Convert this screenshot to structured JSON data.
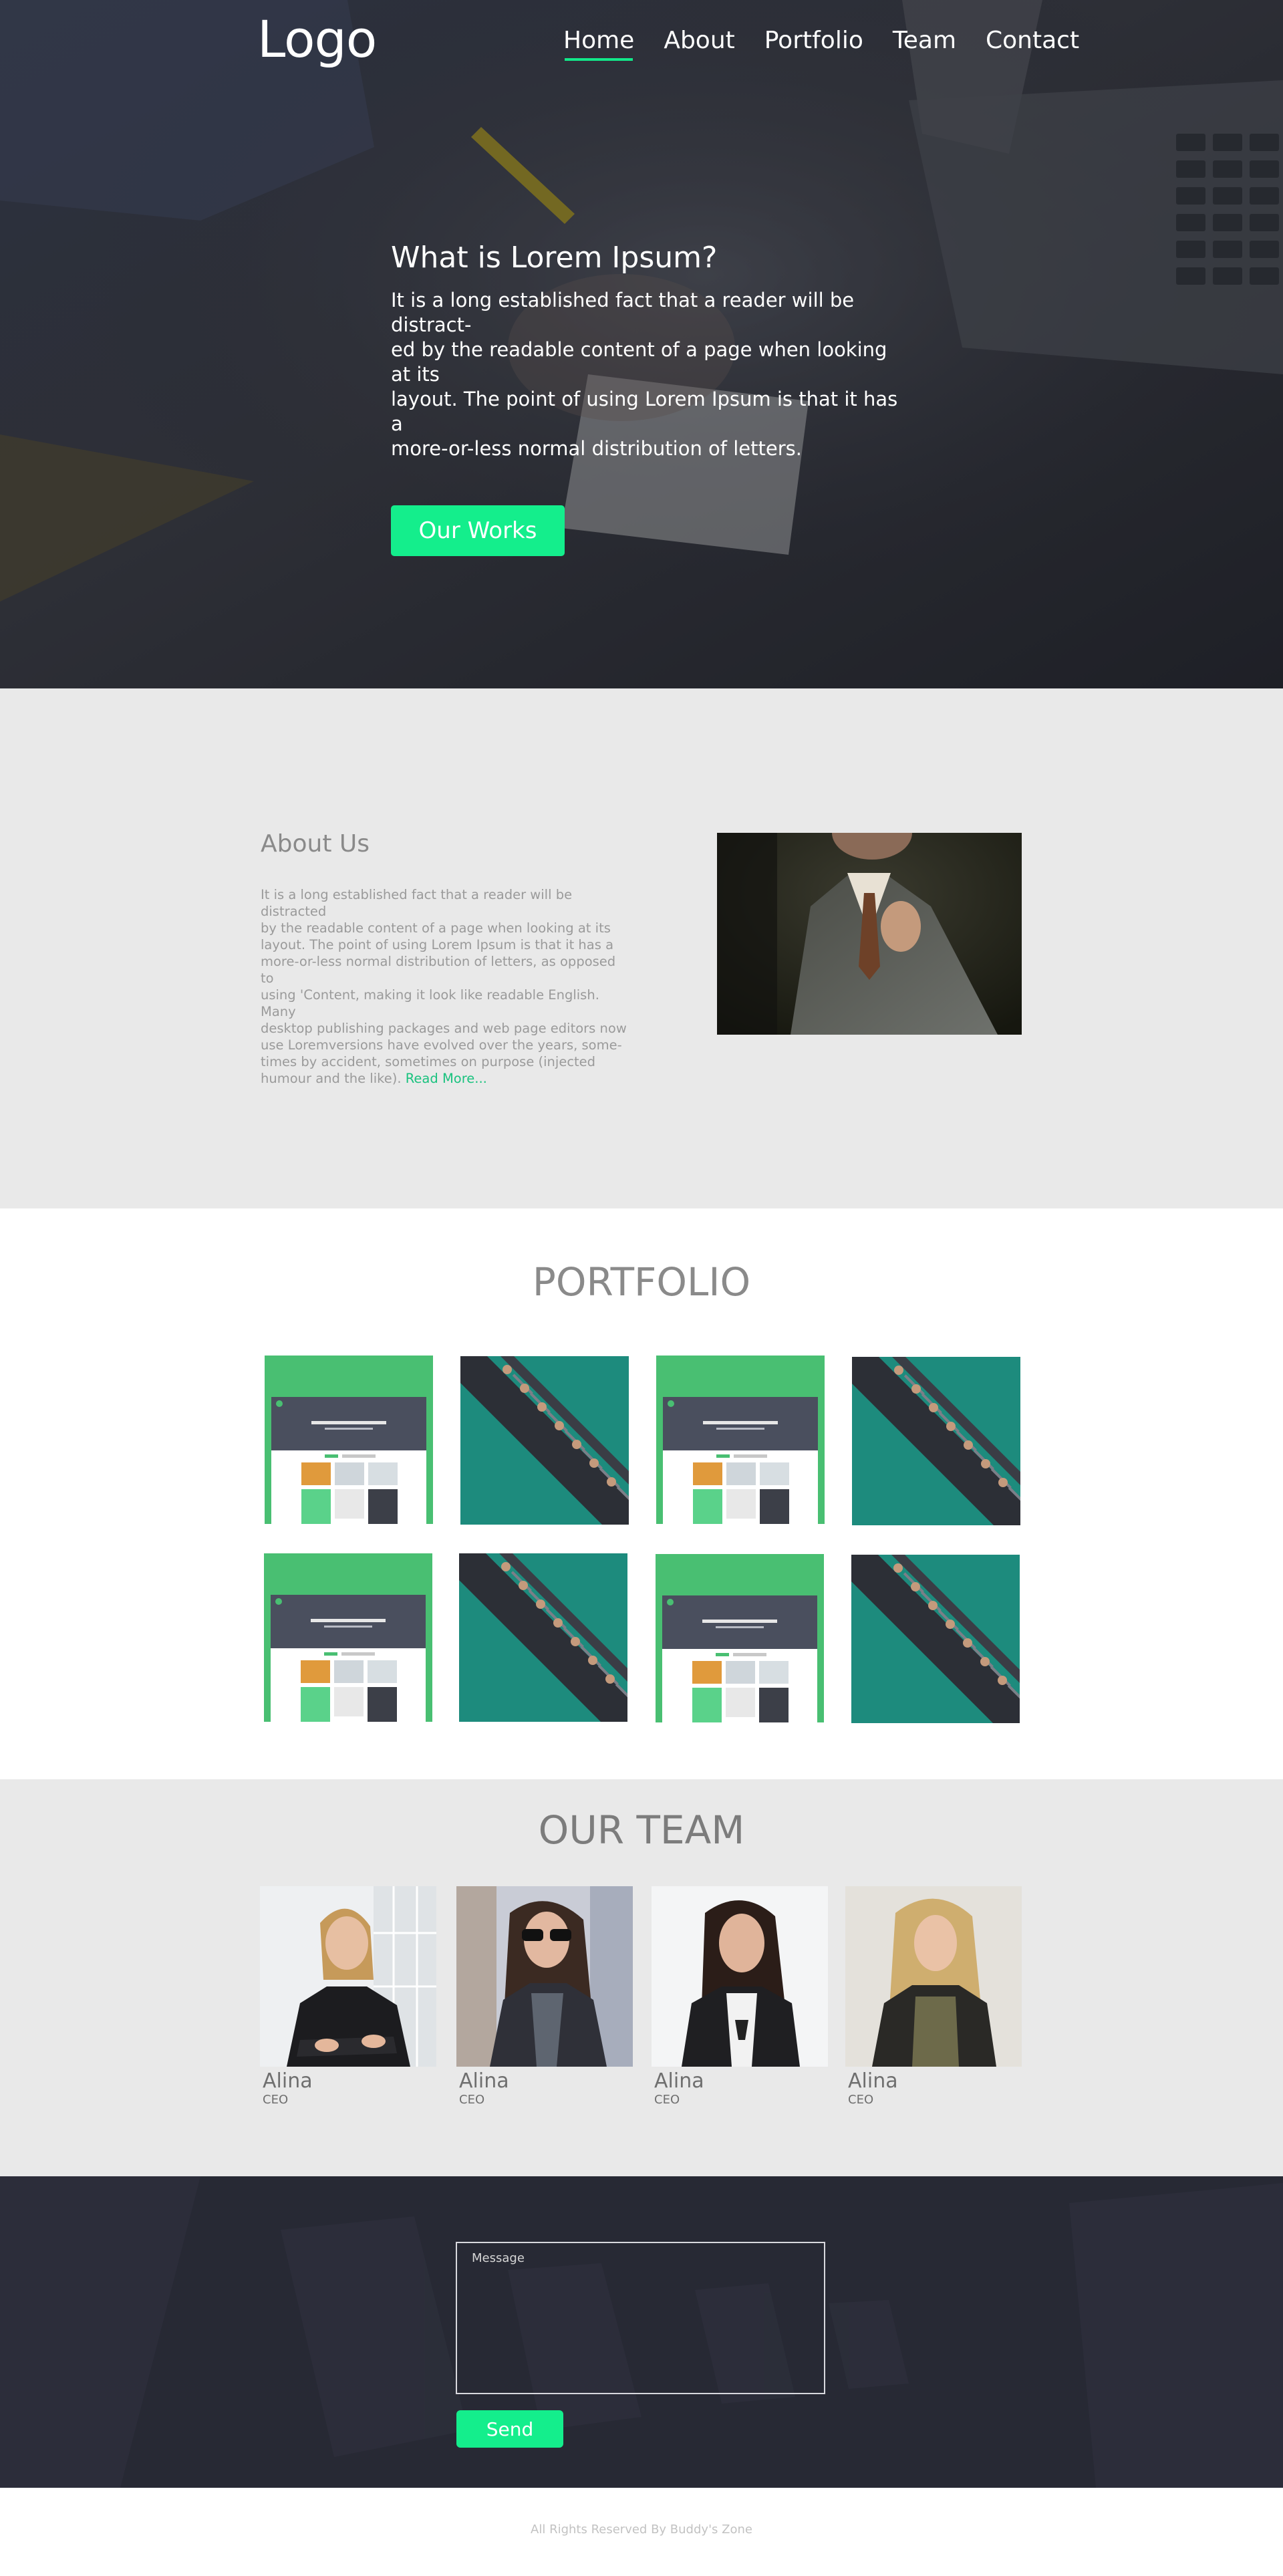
{
  "header": {
    "logo": "Logo",
    "nav": [
      {
        "label": "Home",
        "active": true
      },
      {
        "label": "About",
        "active": false
      },
      {
        "label": "Portfolio",
        "active": false
      },
      {
        "label": "Team",
        "active": false
      },
      {
        "label": "Contact",
        "active": false
      }
    ]
  },
  "hero": {
    "title": "What is Lorem Ipsum?",
    "lines": [
      "It is a long established fact that a reader will be distract-",
      "ed by the readable content of a page when looking at its",
      "layout. The point of using Lorem Ipsum is that it has a",
      "more-or-less normal distribution of letters."
    ],
    "button": "Our Works"
  },
  "about": {
    "title": "About Us",
    "lines": [
      "It is a long established fact that a reader will be distracted",
      "by the readable content of a page when looking at its",
      "layout. The point of using Lorem Ipsum is that it has a",
      "more-or-less normal distribution of letters, as opposed to",
      "using 'Content, making it look like readable English. Many",
      "desktop publishing packages and web page editors now",
      "use Loremversions have evolved over the years, some-",
      "times by accident, sometimes on purpose (injected",
      "humour and the like)."
    ],
    "read_more": "Read More..."
  },
  "portfolio": {
    "title": "PORTFOLIO",
    "items": [
      {
        "kind": "green"
      },
      {
        "kind": "dark"
      },
      {
        "kind": "green"
      },
      {
        "kind": "dark"
      },
      {
        "kind": "green"
      },
      {
        "kind": "dark"
      },
      {
        "kind": "green"
      },
      {
        "kind": "dark"
      }
    ]
  },
  "team": {
    "title": "OUR TEAM",
    "members": [
      {
        "name": "Alina",
        "role": "CEO"
      },
      {
        "name": "Alina",
        "role": "CEO"
      },
      {
        "name": "Alina",
        "role": "CEO"
      },
      {
        "name": "Alina",
        "role": "CEO"
      }
    ]
  },
  "contact": {
    "message_placeholder": "Message",
    "send": "Send"
  },
  "footer": {
    "text": "All Rights Reserved By Buddy's Zone"
  },
  "colors": {
    "accent": "#14ee8c",
    "section_gray": "#e9e9e9",
    "contact_bg": "#2a2c3a"
  }
}
